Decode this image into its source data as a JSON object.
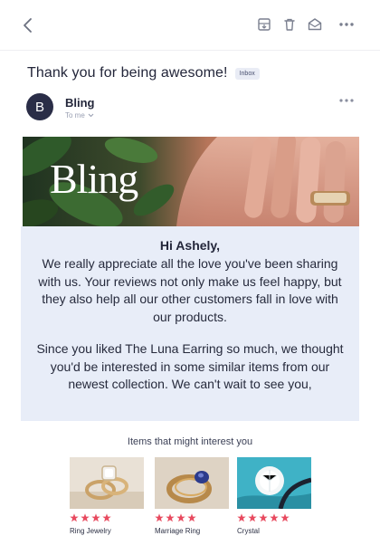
{
  "header": {
    "back_icon": "chevron-left-icon",
    "actions": [
      "archive-icon",
      "trash-icon",
      "mail-open-icon",
      "more-horizontal-icon"
    ]
  },
  "email": {
    "subject": "Thank you for being awesome!",
    "folder_badge": "Inbox",
    "sender": {
      "initial": "B",
      "name": "Bling",
      "to_label": "To me",
      "avatar_color": "#2a2d47"
    }
  },
  "body": {
    "hero_logo": "Bling",
    "greeting": "Hi Ashely,",
    "paragraph1": "We really appreciate all the love you've been sharing with us. Your reviews not only make us feel happy, but they also help all our other customers fall in love with our products.",
    "paragraph2": "Since you liked The Luna Earring so much, we thought you'd be interested in some similar items from our newest collection. We can't wait to see you,",
    "panel_color": "#e8edf8"
  },
  "recommendations": {
    "heading": "Items that might interest you",
    "star_color": "#e84a5f",
    "items": [
      {
        "name": "Ring Jewelry",
        "rating": 4
      },
      {
        "name": "Marriage Ring",
        "rating": 4
      },
      {
        "name": "Crystal",
        "rating": 5
      }
    ]
  }
}
